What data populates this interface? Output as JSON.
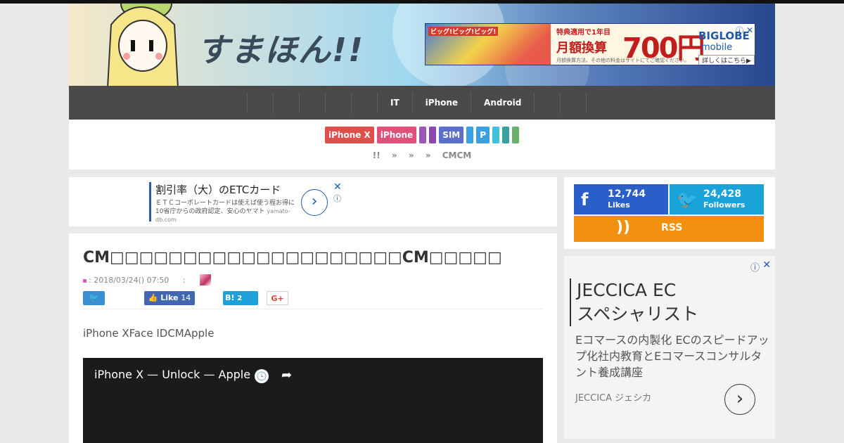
{
  "site": {
    "logo": "すまほん!!"
  },
  "header_ad": {
    "corner_badge": "ビッグ!ビッグ!ビッグ!",
    "sub": "特典適用で1年目",
    "main": "月額換算",
    "price": "700円",
    "note": "月額換算方法、その他の料金はサイトにてご確認ください。",
    "brand": "BIGLOBE",
    "brand2": "mobile",
    "more": "詳しくはこちら▶",
    "close": "✕",
    "info": "ⓘ"
  },
  "nav": {
    "items": [
      "",
      "",
      "",
      "",
      "",
      "IT",
      "iPhone",
      "Android",
      "",
      ""
    ]
  },
  "tags": [
    {
      "label": "iPhone X",
      "color": "#e0504a"
    },
    {
      "label": "iPhone",
      "color": "#e0507a"
    },
    {
      "label": "",
      "color": "#9b59b6"
    },
    {
      "label": "",
      "color": "#8e44ad"
    },
    {
      "label": "SIM",
      "color": "#5b6fc8"
    },
    {
      "label": "",
      "color": "#3aa0e0"
    },
    {
      "label": "P",
      "color": "#3aa0e0"
    },
    {
      "label": "",
      "color": "#40c0e0"
    },
    {
      "label": "",
      "color": "#3aa0a0"
    },
    {
      "label": "",
      "color": "#6ab06a"
    }
  ],
  "breadcrumb": [
    "!!",
    "»",
    "»",
    "»",
    "CMCM"
  ],
  "ad_banner": {
    "title": "割引率（大）のETCカード",
    "desc": "ＥＴＣコーポレートカードは使えば使う程お得に10省庁からの政府認定、安心のヤマト",
    "src": "yamato-db.com",
    "arrow": "›",
    "close": "✕",
    "info": "ⓘ"
  },
  "article": {
    "title": "CM□□□□□□□□□□□□□□□□□□□□CM□□□□□",
    "date": ": 2018/03/24() 07:50",
    "author_sep": ":",
    "lead": "iPhone XFace IDCMApple",
    "share": {
      "twitter_icon": "🐦",
      "facebook": "Like",
      "facebook_count": "14",
      "hatena": "B!",
      "hatena_count": "2",
      "gplus": "G+"
    },
    "video": {
      "title": "iPhone X — Unlock — Apple",
      "clock_icon": "🕓",
      "share_icon": "➦"
    }
  },
  "social": {
    "facebook_count": "12,744",
    "facebook_label": "Likes",
    "twitter_count": "24,428",
    "twitter_label": "Followers",
    "rss_label": "RSS"
  },
  "side_ad": {
    "info": "ⓘ",
    "close": "✕",
    "title_line1": "JECCICA EC",
    "title_line2": "スペシャリスト",
    "desc": "Eコマースの内製化 ECのスピードアップ化社内教育とEコマースコンサルタント養成講座",
    "src": "JECCICA ジェシカ",
    "arrow": "›"
  }
}
